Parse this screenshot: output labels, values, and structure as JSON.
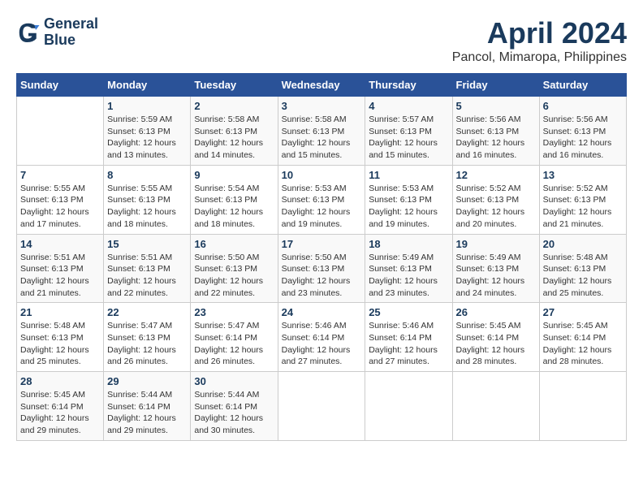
{
  "header": {
    "logo_line1": "General",
    "logo_line2": "Blue",
    "month_year": "April 2024",
    "location": "Pancol, Mimaropa, Philippines"
  },
  "weekdays": [
    "Sunday",
    "Monday",
    "Tuesday",
    "Wednesday",
    "Thursday",
    "Friday",
    "Saturday"
  ],
  "weeks": [
    [
      {
        "day": "",
        "info": ""
      },
      {
        "day": "1",
        "info": "Sunrise: 5:59 AM\nSunset: 6:13 PM\nDaylight: 12 hours\nand 13 minutes."
      },
      {
        "day": "2",
        "info": "Sunrise: 5:58 AM\nSunset: 6:13 PM\nDaylight: 12 hours\nand 14 minutes."
      },
      {
        "day": "3",
        "info": "Sunrise: 5:58 AM\nSunset: 6:13 PM\nDaylight: 12 hours\nand 15 minutes."
      },
      {
        "day": "4",
        "info": "Sunrise: 5:57 AM\nSunset: 6:13 PM\nDaylight: 12 hours\nand 15 minutes."
      },
      {
        "day": "5",
        "info": "Sunrise: 5:56 AM\nSunset: 6:13 PM\nDaylight: 12 hours\nand 16 minutes."
      },
      {
        "day": "6",
        "info": "Sunrise: 5:56 AM\nSunset: 6:13 PM\nDaylight: 12 hours\nand 16 minutes."
      }
    ],
    [
      {
        "day": "7",
        "info": "Sunrise: 5:55 AM\nSunset: 6:13 PM\nDaylight: 12 hours\nand 17 minutes."
      },
      {
        "day": "8",
        "info": "Sunrise: 5:55 AM\nSunset: 6:13 PM\nDaylight: 12 hours\nand 18 minutes."
      },
      {
        "day": "9",
        "info": "Sunrise: 5:54 AM\nSunset: 6:13 PM\nDaylight: 12 hours\nand 18 minutes."
      },
      {
        "day": "10",
        "info": "Sunrise: 5:53 AM\nSunset: 6:13 PM\nDaylight: 12 hours\nand 19 minutes."
      },
      {
        "day": "11",
        "info": "Sunrise: 5:53 AM\nSunset: 6:13 PM\nDaylight: 12 hours\nand 19 minutes."
      },
      {
        "day": "12",
        "info": "Sunrise: 5:52 AM\nSunset: 6:13 PM\nDaylight: 12 hours\nand 20 minutes."
      },
      {
        "day": "13",
        "info": "Sunrise: 5:52 AM\nSunset: 6:13 PM\nDaylight: 12 hours\nand 21 minutes."
      }
    ],
    [
      {
        "day": "14",
        "info": "Sunrise: 5:51 AM\nSunset: 6:13 PM\nDaylight: 12 hours\nand 21 minutes."
      },
      {
        "day": "15",
        "info": "Sunrise: 5:51 AM\nSunset: 6:13 PM\nDaylight: 12 hours\nand 22 minutes."
      },
      {
        "day": "16",
        "info": "Sunrise: 5:50 AM\nSunset: 6:13 PM\nDaylight: 12 hours\nand 22 minutes."
      },
      {
        "day": "17",
        "info": "Sunrise: 5:50 AM\nSunset: 6:13 PM\nDaylight: 12 hours\nand 23 minutes."
      },
      {
        "day": "18",
        "info": "Sunrise: 5:49 AM\nSunset: 6:13 PM\nDaylight: 12 hours\nand 23 minutes."
      },
      {
        "day": "19",
        "info": "Sunrise: 5:49 AM\nSunset: 6:13 PM\nDaylight: 12 hours\nand 24 minutes."
      },
      {
        "day": "20",
        "info": "Sunrise: 5:48 AM\nSunset: 6:13 PM\nDaylight: 12 hours\nand 25 minutes."
      }
    ],
    [
      {
        "day": "21",
        "info": "Sunrise: 5:48 AM\nSunset: 6:13 PM\nDaylight: 12 hours\nand 25 minutes."
      },
      {
        "day": "22",
        "info": "Sunrise: 5:47 AM\nSunset: 6:13 PM\nDaylight: 12 hours\nand 26 minutes."
      },
      {
        "day": "23",
        "info": "Sunrise: 5:47 AM\nSunset: 6:14 PM\nDaylight: 12 hours\nand 26 minutes."
      },
      {
        "day": "24",
        "info": "Sunrise: 5:46 AM\nSunset: 6:14 PM\nDaylight: 12 hours\nand 27 minutes."
      },
      {
        "day": "25",
        "info": "Sunrise: 5:46 AM\nSunset: 6:14 PM\nDaylight: 12 hours\nand 27 minutes."
      },
      {
        "day": "26",
        "info": "Sunrise: 5:45 AM\nSunset: 6:14 PM\nDaylight: 12 hours\nand 28 minutes."
      },
      {
        "day": "27",
        "info": "Sunrise: 5:45 AM\nSunset: 6:14 PM\nDaylight: 12 hours\nand 28 minutes."
      }
    ],
    [
      {
        "day": "28",
        "info": "Sunrise: 5:45 AM\nSunset: 6:14 PM\nDaylight: 12 hours\nand 29 minutes."
      },
      {
        "day": "29",
        "info": "Sunrise: 5:44 AM\nSunset: 6:14 PM\nDaylight: 12 hours\nand 29 minutes."
      },
      {
        "day": "30",
        "info": "Sunrise: 5:44 AM\nSunset: 6:14 PM\nDaylight: 12 hours\nand 30 minutes."
      },
      {
        "day": "",
        "info": ""
      },
      {
        "day": "",
        "info": ""
      },
      {
        "day": "",
        "info": ""
      },
      {
        "day": "",
        "info": ""
      }
    ]
  ]
}
